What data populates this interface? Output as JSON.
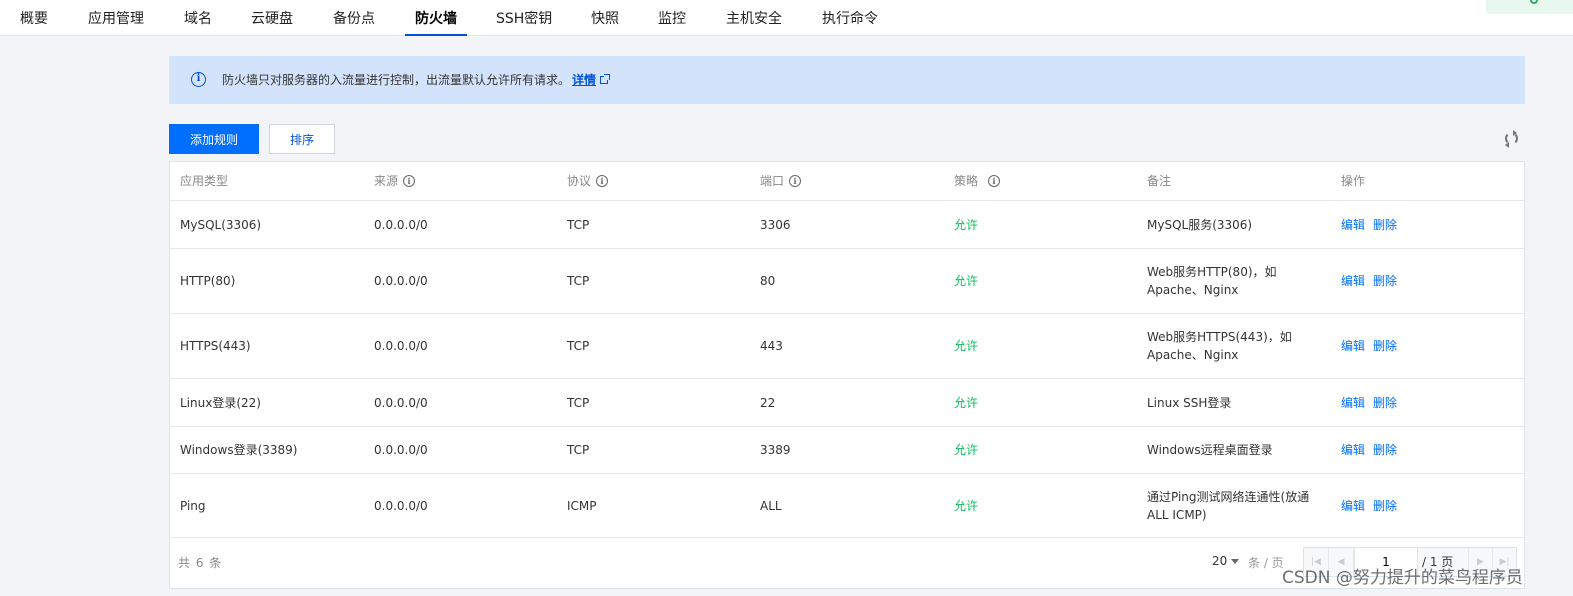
{
  "tabs": [
    {
      "label": "概要",
      "active": false
    },
    {
      "label": "应用管理",
      "active": false
    },
    {
      "label": "域名",
      "active": false
    },
    {
      "label": "云硬盘",
      "active": false
    },
    {
      "label": "备份点",
      "active": false
    },
    {
      "label": "防火墙",
      "active": true
    },
    {
      "label": "SSH密钥",
      "active": false
    },
    {
      "label": "快照",
      "active": false
    },
    {
      "label": "监控",
      "active": false
    },
    {
      "label": "主机安全",
      "active": false
    },
    {
      "label": "执行命令",
      "active": false
    }
  ],
  "banner": {
    "icon": "info-icon",
    "message": "防火墙只对服务器的入流量进行控制，出流量默认允许所有请求。",
    "detail_link": "详情"
  },
  "toolbar": {
    "add_rule_label": "添加规则",
    "sort_label": "排序",
    "refresh_icon": "refresh-icon"
  },
  "table": {
    "columns": [
      {
        "label": "应用类型",
        "info": false
      },
      {
        "label": "来源",
        "info": true
      },
      {
        "label": "协议",
        "info": true
      },
      {
        "label": "端口",
        "info": true
      },
      {
        "label": "策略",
        "info": true
      },
      {
        "label": "备注",
        "info": false
      },
      {
        "label": "操作",
        "info": false
      }
    ],
    "info_glyph": "i",
    "rows": [
      {
        "app": "MySQL(3306)",
        "source": "0.0.0.0/0",
        "protocol": "TCP",
        "port": "3306",
        "policy": "允许",
        "remark": "MySQL服务(3306)",
        "edit": "编辑",
        "delete": "删除"
      },
      {
        "app": "HTTP(80)",
        "source": "0.0.0.0/0",
        "protocol": "TCP",
        "port": "80",
        "policy": "允许",
        "remark": "Web服务HTTP(80)，如 Apache、Nginx",
        "edit": "编辑",
        "delete": "删除"
      },
      {
        "app": "HTTPS(443)",
        "source": "0.0.0.0/0",
        "protocol": "TCP",
        "port": "443",
        "policy": "允许",
        "remark": "Web服务HTTPS(443)，如 Apache、Nginx",
        "edit": "编辑",
        "delete": "删除"
      },
      {
        "app": "Linux登录(22)",
        "source": "0.0.0.0/0",
        "protocol": "TCP",
        "port": "22",
        "policy": "允许",
        "remark": "Linux SSH登录",
        "edit": "编辑",
        "delete": "删除"
      },
      {
        "app": "Windows登录(3389)",
        "source": "0.0.0.0/0",
        "protocol": "TCP",
        "port": "3389",
        "policy": "允许",
        "remark": "Windows远程桌面登录",
        "edit": "编辑",
        "delete": "删除"
      },
      {
        "app": "Ping",
        "source": "0.0.0.0/0",
        "protocol": "ICMP",
        "port": "ALL",
        "policy": "允许",
        "remark": "通过Ping测试网络连通性(放通 ALL ICMP)",
        "edit": "编辑",
        "delete": "删除"
      }
    ]
  },
  "pagination": {
    "total_text": "共 6 条",
    "page_size": "20",
    "per_page_text": "条 / 页",
    "current_page": "1",
    "total_pages_text": "/ 1 页"
  },
  "watermark": "CSDN @努力提升的菜鸟程序员",
  "colors": {
    "primary": "#006eff",
    "allow": "#0abf5b",
    "banner_bg": "#d4e3fc"
  }
}
